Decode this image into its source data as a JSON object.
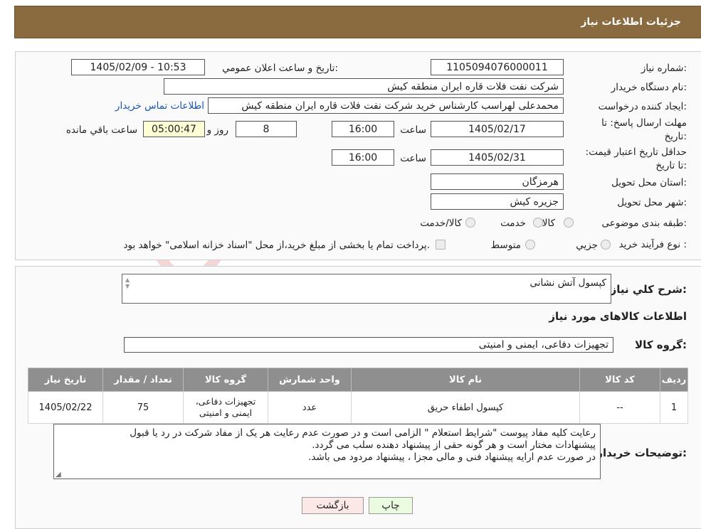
{
  "header": {
    "title": "جزئیات اطلاعات نیاز"
  },
  "fields": {
    "need_number_label": "شماره نیاز:",
    "need_number": "1105094076000011",
    "announce_label": "تاریخ و ساعت اعلان عمومي:",
    "announce_value": "1405/02/09 - 10:53",
    "buyer_label": "نام دستگاه خریدار:",
    "buyer_value": "شرکت نفت فلات قاره ایران منطقه کیش",
    "creator_label": "ایجاد کننده درخواست:",
    "creator_value": "محمدعلی لهراسب کارشناس خرید شرکت نفت فلات قاره ایران منطقه کیش",
    "contact_link": "اطلاعات تماس خریدار",
    "deadline_label": "مهلت ارسال پاسخ: تا تاریخ:",
    "deadline_date": "1405/02/17",
    "time_label": "ساعت",
    "deadline_time": "16:00",
    "days_value": "8",
    "days_label": "روز و",
    "remaining_value": "05:00:47",
    "remaining_label": "ساعت باقي مانده",
    "validity_label": "حداقل تاریخ اعتبار قیمت: تا تاریخ:",
    "validity_date": "1405/02/31",
    "validity_time": "16:00",
    "province_label": "استان محل تحویل:",
    "province_value": "هرمزگان",
    "city_label": "شهر محل تحویل:",
    "city_value": "جزیره کیش",
    "category_label": "طبقه بندی موضوعی:",
    "category_options": [
      "کالا",
      "خدمت",
      "کالا/خدمت"
    ],
    "process_label": "نوع فرآیند خرید :",
    "process_options": [
      "جزيي",
      "متوسط"
    ],
    "process_note": "پرداخت تمام یا بخشی از مبلغ خرید،از محل \"اسناد خزانه اسلامی\" خواهد بود."
  },
  "summary": {
    "desc_label": "شرح كلي نياز:",
    "desc_value": "کپسول آتش نشانی",
    "goods_info_title": "اطلاعات کالاهای مورد نیاز",
    "group_label": "گروه کالا:",
    "group_value": "تجهیزات دفاعی، ایمنی و امنیتی"
  },
  "table": {
    "headers": [
      "ردیف",
      "کد کالا",
      "نام کالا",
      "واحد شمارش",
      "گروه کالا",
      "تعداد / مقدار",
      "تاریخ نیاز"
    ],
    "rows": [
      [
        "1",
        "--",
        "کپسول اطفاء حریق",
        "عدد",
        "تجهیزات دفاعی، ایمنی و امنیتی",
        "75",
        "1405/02/22"
      ]
    ]
  },
  "notes": {
    "label": "توضیحات خریدار:",
    "lines": [
      "رعایت کلیه مفاد  پیوست \"شرایط استعلام \" الزامی است و در صورت عدم رعایت هر یک از مفاد شرکت در رد یا قبول",
      "پیشنهادات مختار است  و هر گونه حقی از پیشنهاد دهنده سلب می گردد.",
      "در صورت عدم ارایه پیشنهاد فنی و مالی مجزا ، پیشنهاد مردود می باشد."
    ]
  },
  "buttons": {
    "back": "بازگشت",
    "print": "چاپ"
  },
  "watermark": {
    "text": "AriaTender.neT"
  },
  "colors": {
    "header": "#8a6a3f",
    "table_header": "#8f8f8f",
    "highlight": "#ffffd6",
    "back_button": "#fde8e8",
    "print_button": "#eafbe0"
  }
}
